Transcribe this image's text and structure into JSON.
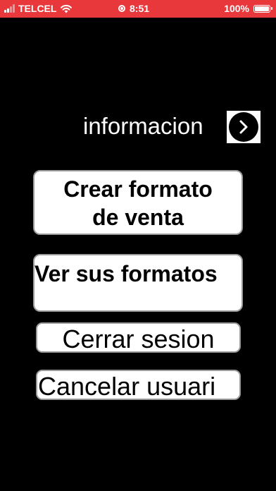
{
  "status_bar": {
    "carrier": "TELCEL",
    "time": "8:51",
    "battery": "100%",
    "battery_level": 1.0,
    "background_color": "#e8383b"
  },
  "info": {
    "label": "informacion",
    "button_icon": "chevron-right-icon"
  },
  "buttons": {
    "crear_formato_line1": "Crear formato",
    "crear_formato_line2": "de venta",
    "ver_formatos": "Ver sus formatos",
    "cerrar_sesion": "Cerrar sesion",
    "cancelar_usuario": "Cancelar usuari"
  }
}
